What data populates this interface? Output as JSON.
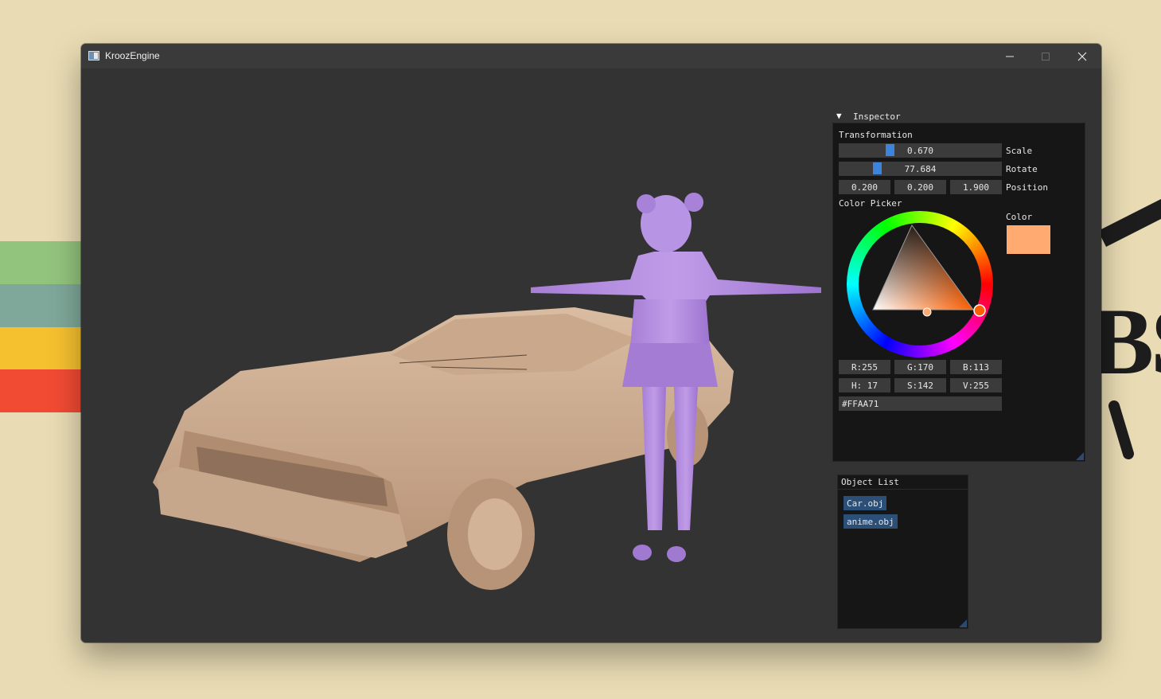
{
  "window": {
    "title": "KroozEngine",
    "controls": {
      "minimize": "—",
      "maximize": "☐",
      "close": "✕"
    }
  },
  "inspector": {
    "header": "Inspector",
    "collapse_glyph": "▼",
    "transformation_label": "Transformation",
    "scale": {
      "value": "0.670",
      "label": "Scale",
      "slider_fraction": 0.31
    },
    "rotate": {
      "value": "77.684",
      "label": "Rotate",
      "slider_fraction": 0.23
    },
    "position": {
      "x": "0.200",
      "y": "0.200",
      "z": "1.900",
      "label": "Position"
    },
    "color_picker_label": "Color Picker",
    "color_label": "Color",
    "color_hex_value": "#FFAA71",
    "rgb": {
      "r": "R:255",
      "g": "G:170",
      "b": "B:113"
    },
    "hsv": {
      "h": "H: 17",
      "s": "S:142",
      "v": "V:255"
    },
    "hex_input": "#FFAA71"
  },
  "object_list": {
    "title": "Object List",
    "items": [
      {
        "label": "Car.obj"
      },
      {
        "label": "anime.obj"
      }
    ]
  },
  "scene": {
    "car_color": "#d9b89c",
    "character_color": "#b48ee0"
  },
  "desktop": {
    "stripe_colors": [
      "#93c47d",
      "#7fa89a",
      "#f6c12f",
      "#f24b33"
    ],
    "deco_text": "BS"
  }
}
